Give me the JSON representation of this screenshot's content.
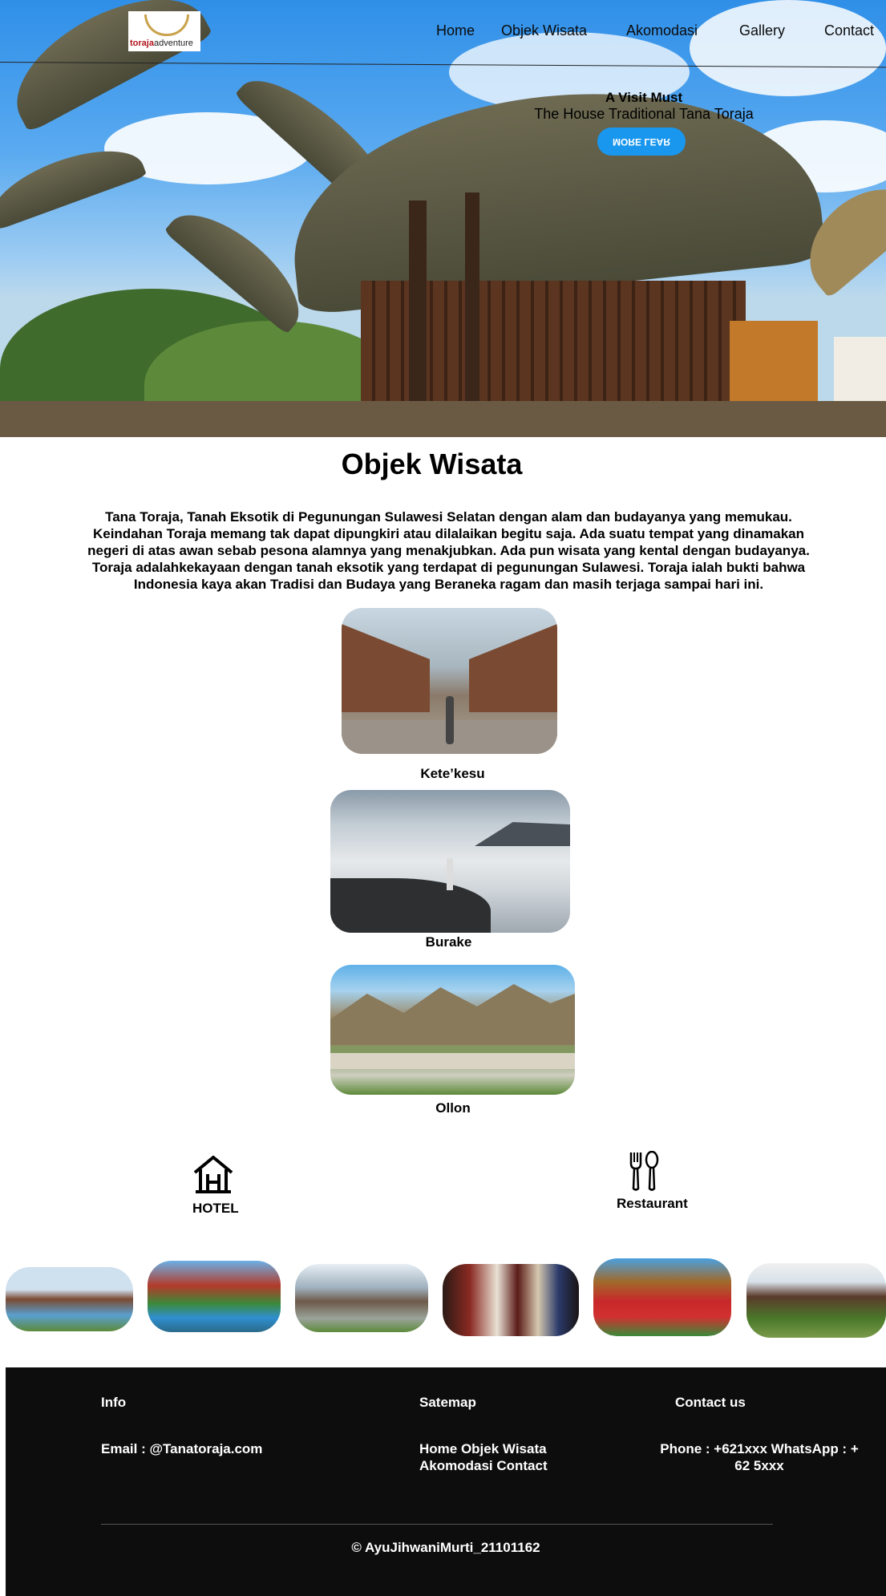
{
  "brand": {
    "logo_red": "toraja",
    "logo_dark": "adventure"
  },
  "nav": {
    "items": [
      {
        "label": "Home"
      },
      {
        "label": "Objek Wisata"
      },
      {
        "label": "Akomodasi"
      },
      {
        "label": "Gallery"
      },
      {
        "label": "Contact"
      }
    ]
  },
  "hero": {
    "title": "A  Visit Must",
    "subtitle": "The House Traditional Tana Toraja",
    "button_label": "MORE LEAR"
  },
  "main": {
    "title": "Objek Wisata",
    "intro": "Tana Toraja, Tanah Eksotik di Pegunungan Sulawesi Selatan dengan alam dan budayanya yang memukau. Keindahan Toraja memang tak dapat dipungkiri atau dilalaikan begitu saja. Ada suatu tempat yang dinamakan negeri di atas awan sebab pesona alamnya yang menakjubkan. Ada pun wisata yang kental dengan budayanya. Toraja adalahkekayaan dengan tanah eksotik yang terdapat di pegunungan Sulawesi. Toraja ialah bukti bahwa Indonesia kaya akan Tradisi dan Budaya yang Beraneka ragam dan masih terjaga sampai hari ini.",
    "destinations": [
      {
        "name": "Kete’kesu"
      },
      {
        "name": "Burake"
      },
      {
        "name": "Ollon"
      }
    ]
  },
  "services": [
    {
      "label": "HOTEL",
      "icon": "hotel-icon"
    },
    {
      "label": "Restaurant",
      "icon": "fork-spoon-icon"
    }
  ],
  "footer": {
    "info_heading": "Info",
    "info_text": "Email : @Tanatoraja.com",
    "sitemap_heading": "Satemap",
    "sitemap_text": "Home Objek Wisata Akomodasi Contact",
    "contact_heading": "Contact us",
    "contact_text": "Phone : +621xxx WhatsApp : + 62 5xxx",
    "copyright": "© AyuJihwaniMurti_21101162"
  },
  "colors": {
    "accent": "#1996ee",
    "footer_bg": "#0d0d0d"
  }
}
